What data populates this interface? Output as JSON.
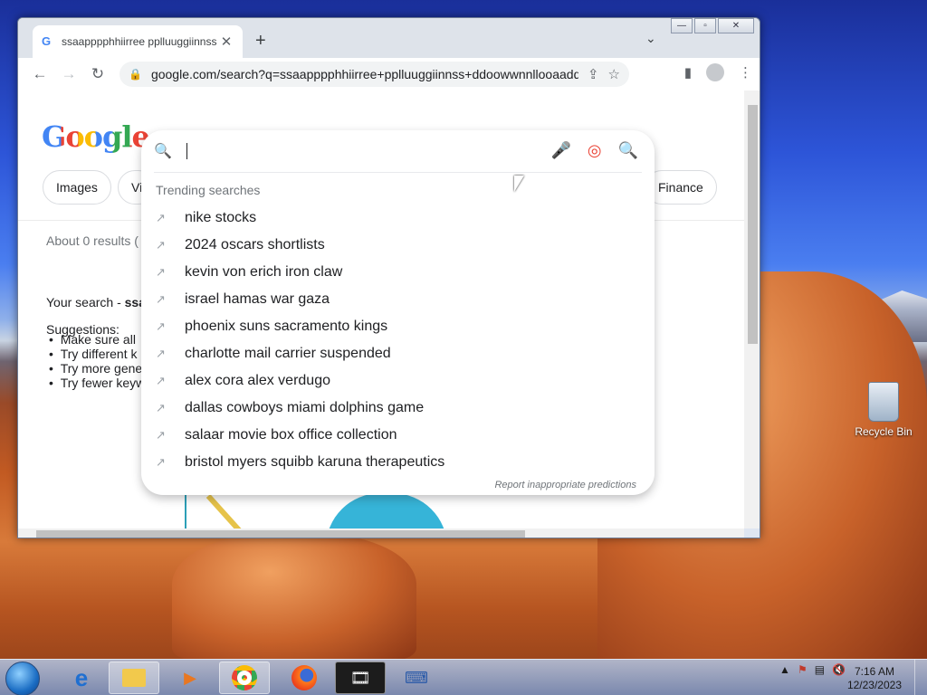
{
  "desktop": {
    "recycle_bin_label": "Recycle Bin"
  },
  "browser": {
    "tab_title": "ssaapppphhiirree pplluuggiinnss",
    "tab_favicon": "G",
    "url": "google.com/search?q=ssaapppphhiirree+pplluuggiinnss+ddoowwnnllooaadd..."
  },
  "google": {
    "logo": "Google",
    "chips": [
      "Images",
      "Vi",
      "Finance"
    ],
    "results_text": "About 0 results (",
    "your_search_prefix": "Your search - ",
    "your_search_term": "ssa",
    "suggestions_heading": "Suggestions:",
    "bullets": [
      "Make sure all",
      "Try different k",
      "Try more gene",
      "Try fewer keyw"
    ]
  },
  "dropdown": {
    "trending_title": "Trending searches",
    "suggestions": [
      "nike stocks",
      "2024 oscars shortlists",
      "kevin von erich iron claw",
      "israel hamas war gaza",
      "phoenix suns sacramento kings",
      "charlotte mail carrier suspended",
      "alex cora alex verdugo",
      "dallas cowboys miami dolphins game",
      "salaar movie box office collection",
      "bristol myers squibb karuna therapeutics"
    ],
    "report_text": "Report inappropriate predictions"
  },
  "taskbar": {
    "time": "7:16 AM",
    "date": "12/23/2023"
  }
}
